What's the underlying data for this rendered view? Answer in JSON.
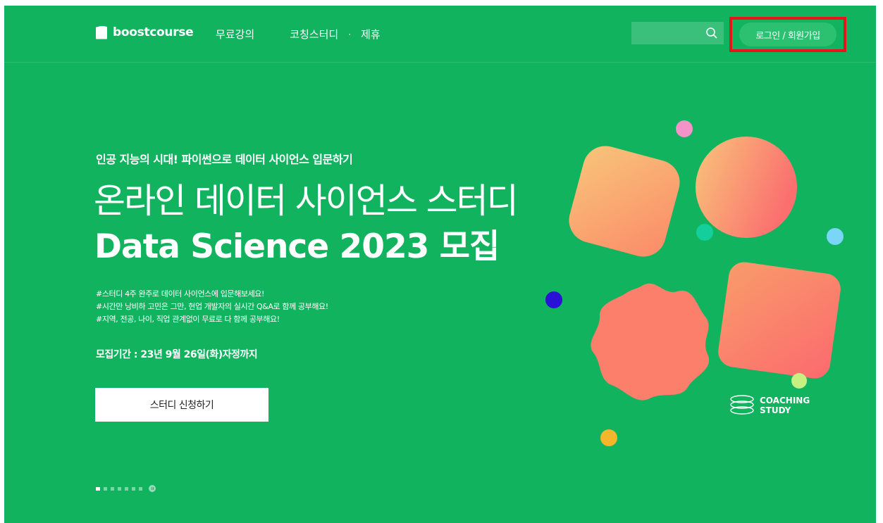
{
  "header": {
    "logo_text": "boostcourse",
    "nav": [
      "무료강의",
      "코칭스터디",
      "·",
      "제휴"
    ],
    "search_placeholder": "",
    "login_label": "로그인 / 회원가입"
  },
  "hero": {
    "kicker": "인공 지능의 시대! 파이썬으로 데이터 사이언스 입문하기",
    "title_line1": "온라인 데이터 사이언스 스터디",
    "title_line2": "Data Science 2023 모집",
    "desc": [
      "#스터디 4주 완주로 데이터 사이언스에 입문해보세요!",
      "#시간만 낭비하 고민은 그만, 현업 개발자의 실시간 Q&A로 함께 공부해요!",
      "#지역, 전공, 나이, 직업 관계없이 무료로 다 함께 공부해요!"
    ],
    "period": "모집기간 : 23년 9월 26일(화)자정까지",
    "cta_label": "스터디 신청하기",
    "badge_line1": "COACHING",
    "badge_line2": "STUDY"
  },
  "pager": {
    "total": 7,
    "current": 1
  },
  "colors": {
    "background": "#11b35f",
    "highlight": "#e8141b",
    "accent_coral": "#fb6f6f",
    "accent_peach": "#f9b972"
  }
}
